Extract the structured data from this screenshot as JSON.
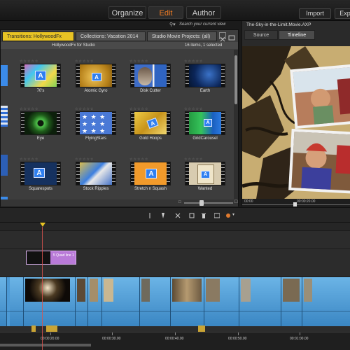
{
  "topbar": {
    "modes": [
      "Organize",
      "Edit",
      "Author"
    ],
    "active_mode": "Edit",
    "right_buttons": [
      "Import",
      "Exp"
    ]
  },
  "library": {
    "tabs": [
      "Transitions: HollywoodFx",
      "Collections: Vacation 2014",
      "Studio Movie Projects: (all)"
    ],
    "active_tab": "Transitions: HollywoodFx",
    "subheader": "HollywoodFx for Studio",
    "item_count": "16 items, 1 selected",
    "search_placeholder": "Search your current view",
    "items": [
      {
        "label": "70's"
      },
      {
        "label": "Atomic Gyro"
      },
      {
        "label": "Disk Cutter"
      },
      {
        "label": "Earth"
      },
      {
        "label": "Eye"
      },
      {
        "label": "FlyingStars"
      },
      {
        "label": "Gold Hoops"
      },
      {
        "label": "GridCarousel"
      },
      {
        "label": "Squarespots"
      },
      {
        "label": "Stock Ripples"
      },
      {
        "label": "Stretch n Squash"
      },
      {
        "label": "Wanted"
      }
    ]
  },
  "player": {
    "title": "The-Sky-in-the-Limit.Movie.AXP",
    "tabs": [
      "Source",
      "Timeline"
    ],
    "active_tab": "Timeline",
    "ruler": [
      "00:00",
      "00:00:20.00"
    ]
  },
  "timeline": {
    "title_clip_label": "5 Quad line 1",
    "timecodes": [
      "00:00:20.00",
      "00:00:30.00",
      "00:00:40.00",
      "00:00:50.00",
      "00:01:00.00"
    ]
  },
  "colors": {
    "accent": "#ef7b23",
    "active_tab": "#e8c324",
    "video_track": "#4c9ad6",
    "title_clip": "#b97ad8"
  }
}
